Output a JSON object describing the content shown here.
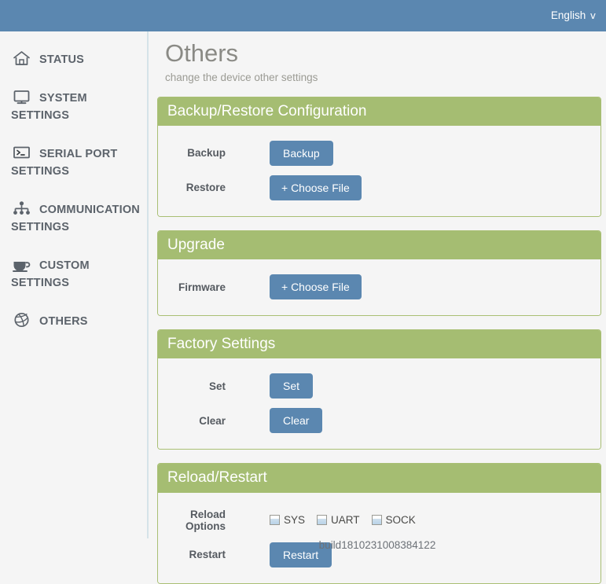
{
  "topbar": {
    "language_label": "English",
    "chevron": "∨"
  },
  "sidebar": {
    "items": [
      {
        "label": "STATUS",
        "icon": "home-icon"
      },
      {
        "label": "SYSTEM SETTINGS",
        "icon": "monitor-icon"
      },
      {
        "label": "SERIAL PORT SETTINGS",
        "icon": "terminal-icon"
      },
      {
        "label": "COMMUNICATION SETTINGS",
        "icon": "sitemap-icon"
      },
      {
        "label": "CUSTOM SETTINGS",
        "icon": "coffee-cup-icon"
      },
      {
        "label": "OTHERS",
        "icon": "dribbble-ball-icon"
      }
    ]
  },
  "page": {
    "title": "Others",
    "subtitle": "change the device other settings"
  },
  "panels": {
    "backup_restore": {
      "title": "Backup/Restore Configuration",
      "rows": [
        {
          "label": "Backup",
          "button": "Backup"
        },
        {
          "label": "Restore",
          "button": "+ Choose File"
        }
      ]
    },
    "upgrade": {
      "title": "Upgrade",
      "rows": [
        {
          "label": "Firmware",
          "button": "+ Choose File"
        }
      ]
    },
    "factory": {
      "title": "Factory Settings",
      "rows": [
        {
          "label": "Set",
          "button": "Set"
        },
        {
          "label": "Clear",
          "button": "Clear"
        }
      ]
    },
    "reload_restart": {
      "title": "Reload/Restart",
      "reload_label": "Reload Options",
      "options": [
        {
          "label": "SYS",
          "checked": false
        },
        {
          "label": "UART",
          "checked": false
        },
        {
          "label": "SOCK",
          "checked": false
        }
      ],
      "restart_label": "Restart",
      "restart_button": "Restart"
    }
  },
  "footer": {
    "build": "build1810231008384122"
  },
  "colors": {
    "topbar_blue": "#5b87b0",
    "button_blue": "#5b87b0",
    "panel_green": "#a5bd72",
    "panel_border_green": "#a9bf74",
    "page_background": "#f5f5f5",
    "sidebar_divider": "#d5e3e8"
  }
}
